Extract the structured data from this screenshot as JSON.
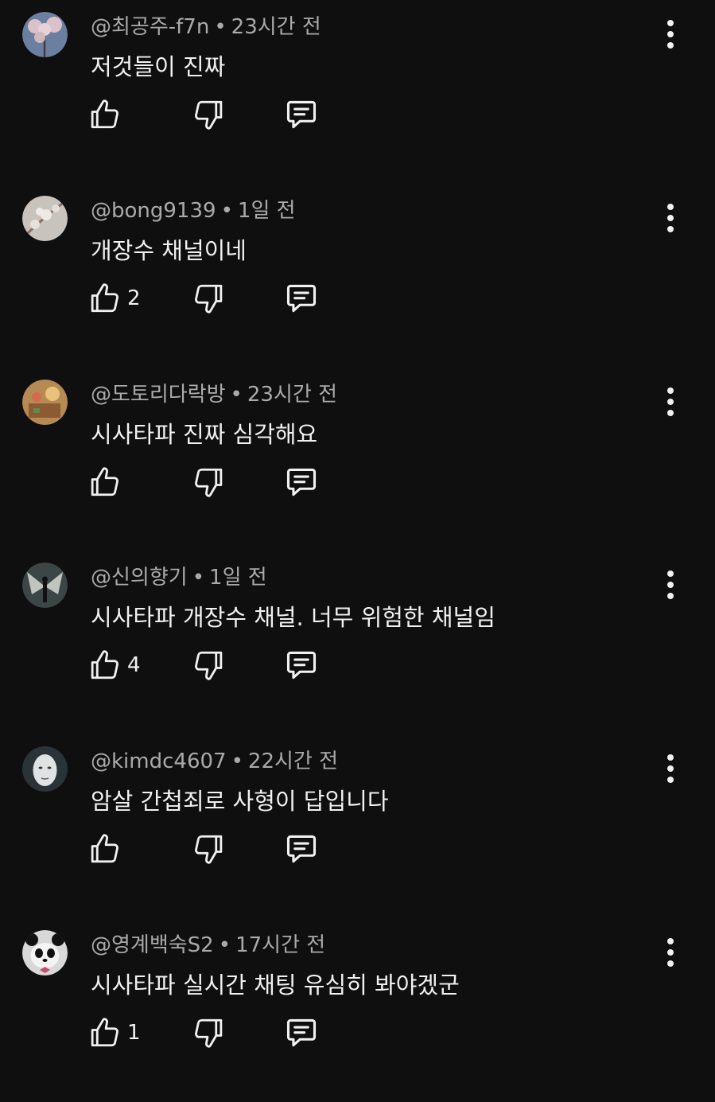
{
  "comments": [
    {
      "author": "@최공주-f7n",
      "time": "23시간 전",
      "text": "저것들이 진짜",
      "likes": "",
      "avatar": {
        "bg": "#6b7fa0",
        "fg": "#d9c2c8",
        "icon": "cherry-blossom-avatar"
      }
    },
    {
      "author": "@bong9139",
      "time": "1일 전",
      "text": "개장수 채널이네",
      "likes": "2",
      "avatar": {
        "bg": "#c9c3bd",
        "fg": "#8a6f66",
        "icon": "blossom-branch-avatar"
      }
    },
    {
      "author": "@도토리다락방",
      "time": "23시간 전",
      "text": "시사타파 진짜 심각해요",
      "likes": "",
      "avatar": {
        "bg": "#b68a55",
        "fg": "#e8c27a",
        "icon": "illustration-avatar"
      }
    },
    {
      "author": "@신의향기",
      "time": "1일 전",
      "text": "시사타파 개장수 채널.  너무 위험한 채널임",
      "likes": "4",
      "avatar": {
        "bg": "#3c4646",
        "fg": "#d7dcd6",
        "icon": "winged-figure-avatar"
      }
    },
    {
      "author": "@kimdc4607",
      "time": "22시간 전",
      "text": "암살 간첩죄로 사형이 답입니다",
      "likes": "",
      "avatar": {
        "bg": "#2a3338",
        "fg": "#dfe3e4",
        "icon": "face-avatar"
      }
    },
    {
      "author": "@영계백숙S2",
      "time": "17시간 전",
      "text": "시사타파 실시간 채팅 유심히 봐야겠군",
      "likes": "1",
      "avatar": {
        "bg": "#d8d8d8",
        "fg": "#111111",
        "icon": "panda-avatar"
      }
    }
  ]
}
